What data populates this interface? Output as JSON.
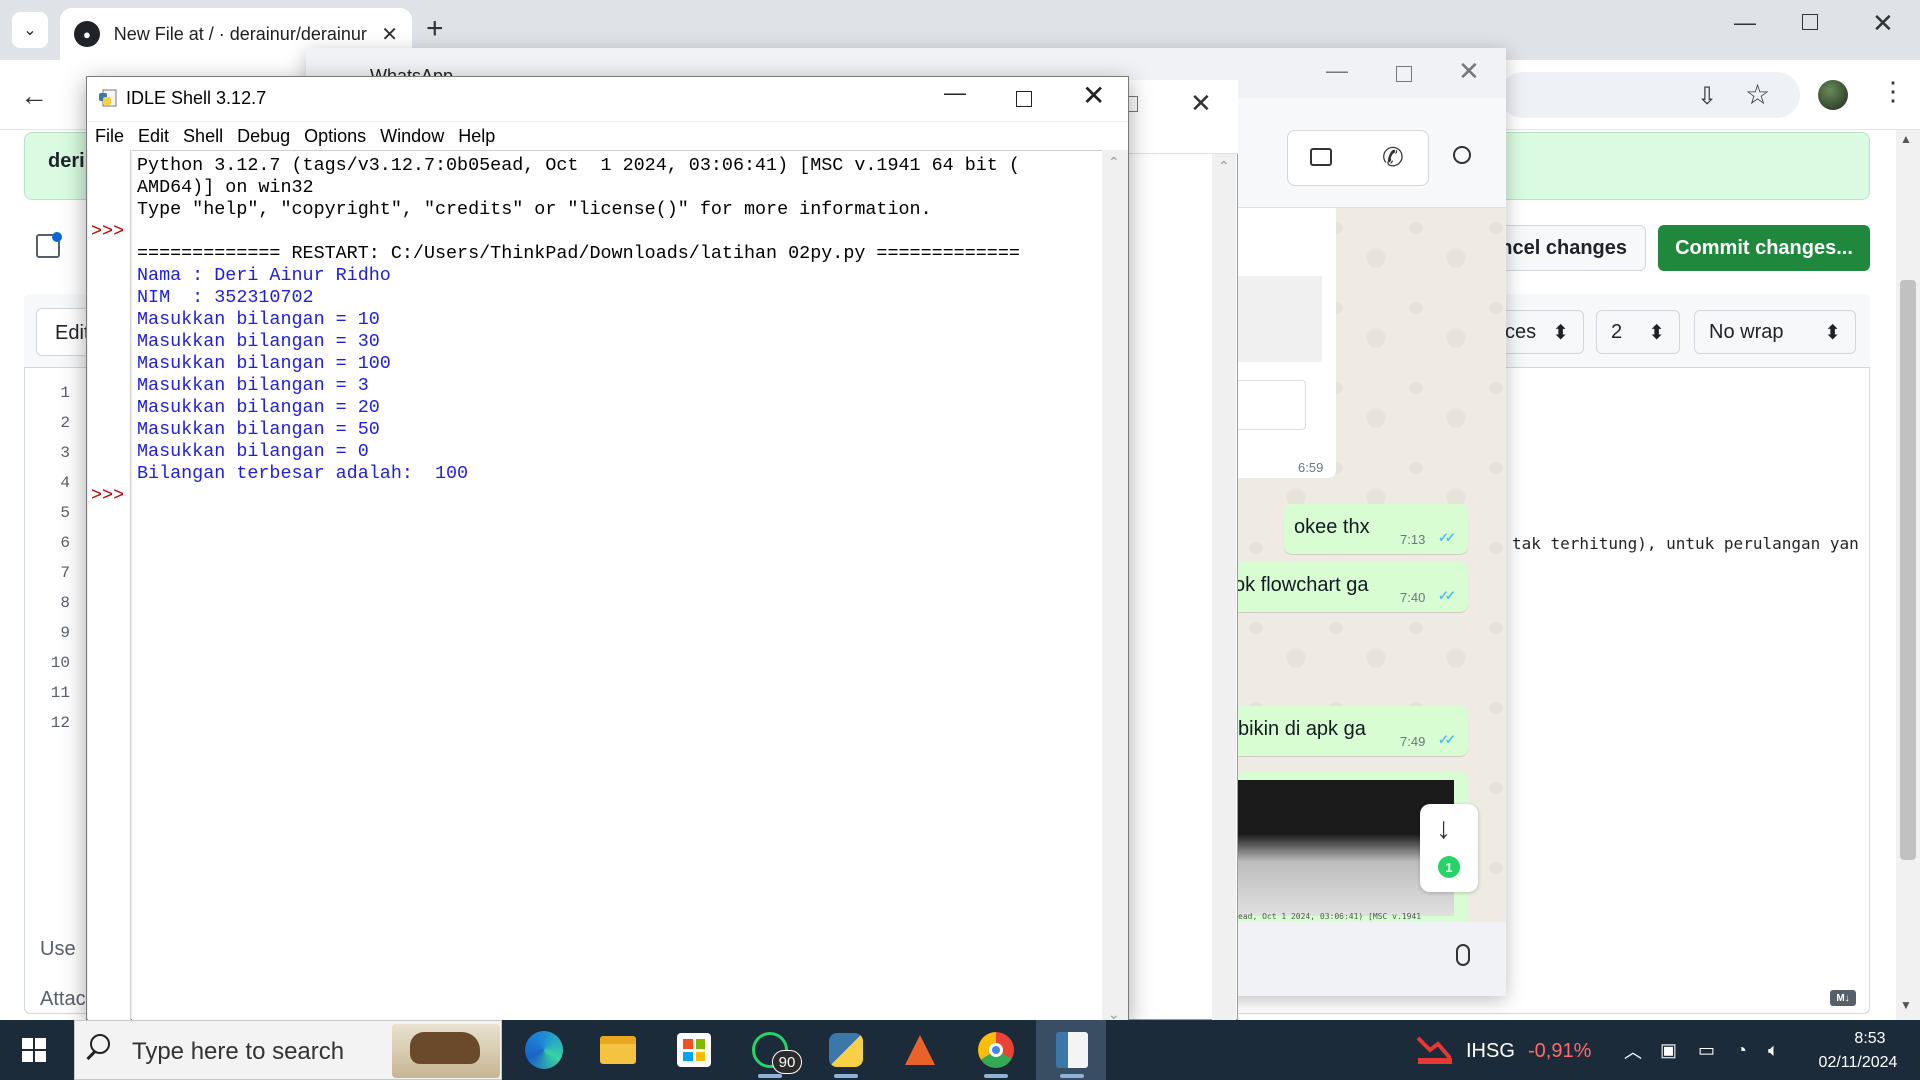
{
  "chrome": {
    "tab_title": "New File at / · derainur/derainur",
    "new_tab": "+",
    "close_tab": "✕",
    "minimize": "—",
    "close": "✕",
    "back": "←"
  },
  "github": {
    "banner_text": "deri",
    "cancel_label": "ncel changes",
    "commit_label": "Commit changes...",
    "edit_tab": "Edit",
    "indent_mode": "ces",
    "indent_size": "2",
    "wrap_mode": "No wrap",
    "line_numbers": [
      "1",
      "2",
      "3",
      "4",
      "5",
      "6",
      "7",
      "8",
      "9",
      "10",
      "11",
      "12"
    ],
    "code_fragment": "tak terhitung), untuk perulangan yan",
    "use_text": "Use",
    "attach_text": "Attac",
    "md_badge": "M↓"
  },
  "whatsapp": {
    "title": "WhatsApp",
    "messages": [
      {
        "text": "okee thx",
        "time": "7:13"
      },
      {
        "text": "ok flowchart ga",
        "time": "7:40"
      },
      {
        "text": "bikin di apk ga",
        "time": "7:49"
      }
    ],
    "earlier_time": "6:59",
    "unread_count": "1",
    "image_caption": "ead, Oct  1 2024, 03:06:41) [MSC v.1941",
    "colors": {
      "bubble": "#d9fdd3",
      "tick": "#53bdeb"
    }
  },
  "idle": {
    "title": "IDLE Shell 3.12.7",
    "menu": [
      "File",
      "Edit",
      "Shell",
      "Debug",
      "Options",
      "Window",
      "Help"
    ],
    "prompt": ">>>",
    "banner": [
      "Python 3.12.7 (tags/v3.12.7:0b05ead, Oct  1 2024, 03:06:41) [MSC v.1941 64 bit (",
      "AMD64)] on win32",
      "Type \"help\", \"copyright\", \"credits\" or \"license()\" for more information."
    ],
    "restart_line": "============= RESTART: C:/Users/ThinkPad/Downloads/latihan 02py.py =============",
    "output": [
      "Nama : Deri Ainur Ridho",
      "NIM  : 352310702",
      "Masukkan bilangan = 10",
      "Masukkan bilangan = 30",
      "Masukkan bilangan = 100",
      "Masukkan bilangan = 3",
      "Masukkan bilangan = 20",
      "Masukkan bilangan = 50",
      "Masukkan bilangan = 0",
      "Bilangan terbesar adalah:  100"
    ],
    "colors": {
      "prompt": "#c00000",
      "output": "#1f1fdb"
    }
  },
  "taskbar": {
    "search_placeholder": "Type here to search",
    "whatsapp_badge": "90",
    "ihsg_label": "IHSG",
    "ihsg_value": "-0,91%",
    "time": "8:53",
    "date": "02/11/2024"
  }
}
